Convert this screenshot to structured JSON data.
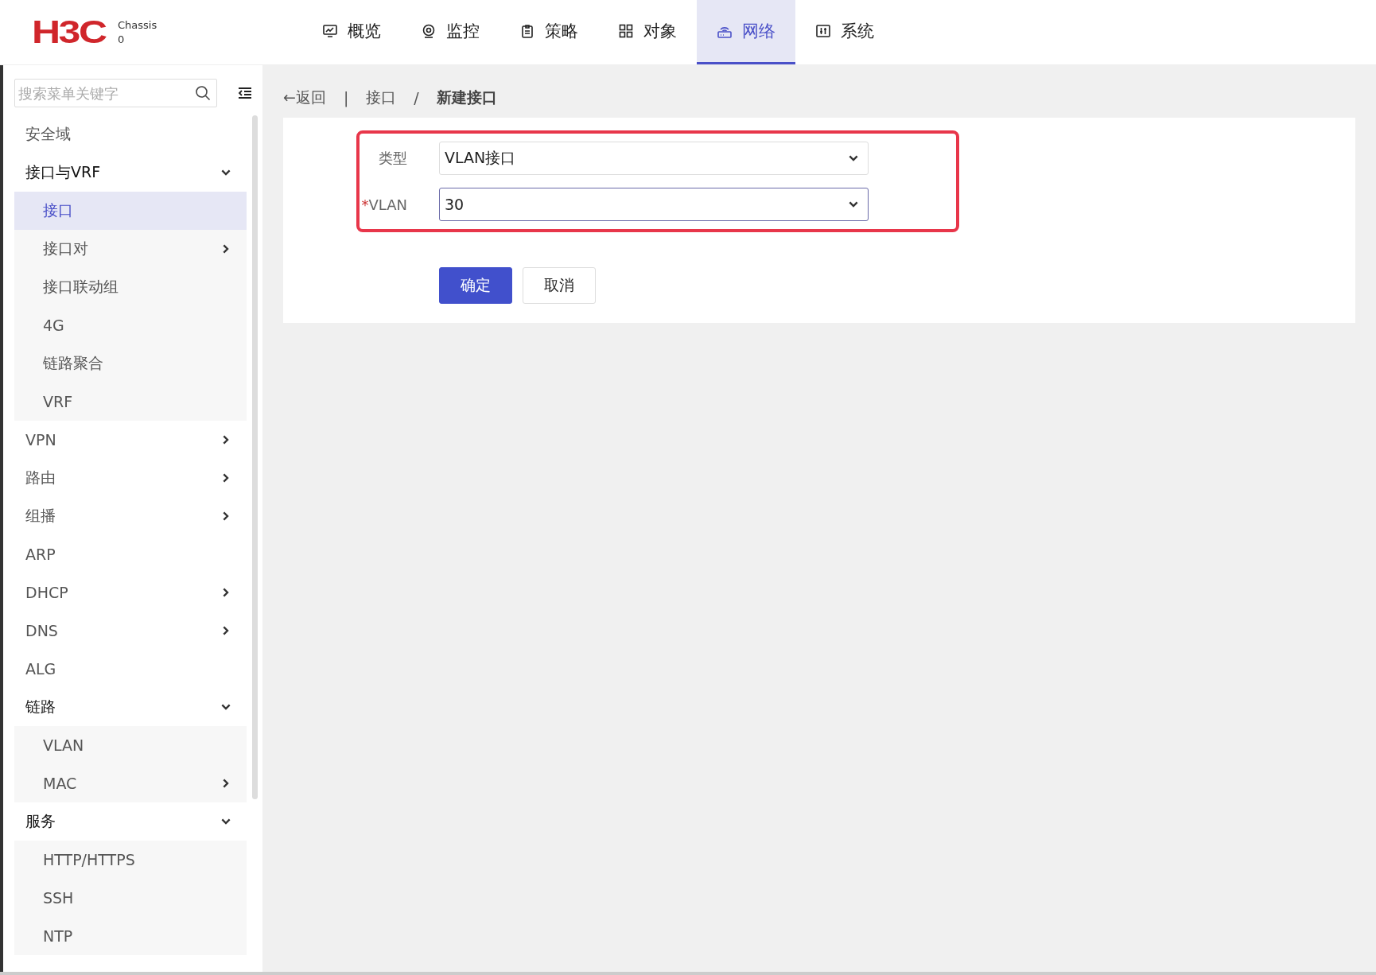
{
  "header": {
    "logo": "H3C",
    "device_label": "Chassis",
    "device_value": "0",
    "tabs": [
      {
        "label": "概览",
        "selected": false
      },
      {
        "label": "监控",
        "selected": false
      },
      {
        "label": "策略",
        "selected": false
      },
      {
        "label": "对象",
        "selected": false
      },
      {
        "label": "网络",
        "selected": true
      },
      {
        "label": "系统",
        "selected": false
      }
    ]
  },
  "sidebar": {
    "search": {
      "placeholder": "搜索菜单关键字"
    },
    "items": [
      {
        "label": "安全域",
        "kind": "link"
      },
      {
        "label": "接口与VRF",
        "kind": "submenu",
        "expanded": true,
        "children": [
          {
            "label": "接口",
            "kind": "link",
            "selected": true
          },
          {
            "label": "接口对",
            "kind": "submenu",
            "expanded": false,
            "selected": false
          },
          {
            "label": "接口联动组",
            "kind": "link",
            "selected": false
          },
          {
            "label": "4G",
            "kind": "link",
            "selected": false
          },
          {
            "label": "链路聚合",
            "kind": "link",
            "selected": false
          },
          {
            "label": "VRF",
            "kind": "link",
            "selected": false
          }
        ]
      },
      {
        "label": "VPN",
        "kind": "submenu",
        "expanded": false
      },
      {
        "label": "路由",
        "kind": "submenu",
        "expanded": false
      },
      {
        "label": "组播",
        "kind": "submenu",
        "expanded": false
      },
      {
        "label": "ARP",
        "kind": "link"
      },
      {
        "label": "DHCP",
        "kind": "submenu",
        "expanded": false
      },
      {
        "label": "DNS",
        "kind": "submenu",
        "expanded": false
      },
      {
        "label": "ALG",
        "kind": "link"
      },
      {
        "label": "链路",
        "kind": "submenu",
        "expanded": true,
        "children": [
          {
            "label": "VLAN",
            "kind": "link",
            "selected": false
          },
          {
            "label": "MAC",
            "kind": "submenu",
            "expanded": false,
            "selected": false
          }
        ]
      },
      {
        "label": "服务",
        "kind": "submenu",
        "expanded": true,
        "children": [
          {
            "label": "HTTP/HTTPS",
            "kind": "link",
            "selected": false
          },
          {
            "label": "SSH",
            "kind": "link",
            "selected": false
          },
          {
            "label": "NTP",
            "kind": "link",
            "selected": false
          }
        ]
      }
    ]
  },
  "breadcrumb": {
    "back": "←返回",
    "separator": "|",
    "items": [
      "接口",
      "新建接口"
    ],
    "divider": "/"
  },
  "form": {
    "highlighted": true,
    "fields": [
      {
        "label": "类型",
        "value": "VLAN接口",
        "focused": false
      },
      {
        "label": "VLAN",
        "required_mark": "*",
        "value": "30",
        "focused": true
      }
    ],
    "buttons": [
      {
        "label": "确定",
        "kind": "primary"
      },
      {
        "label": "取消",
        "kind": "secondary"
      }
    ]
  }
}
